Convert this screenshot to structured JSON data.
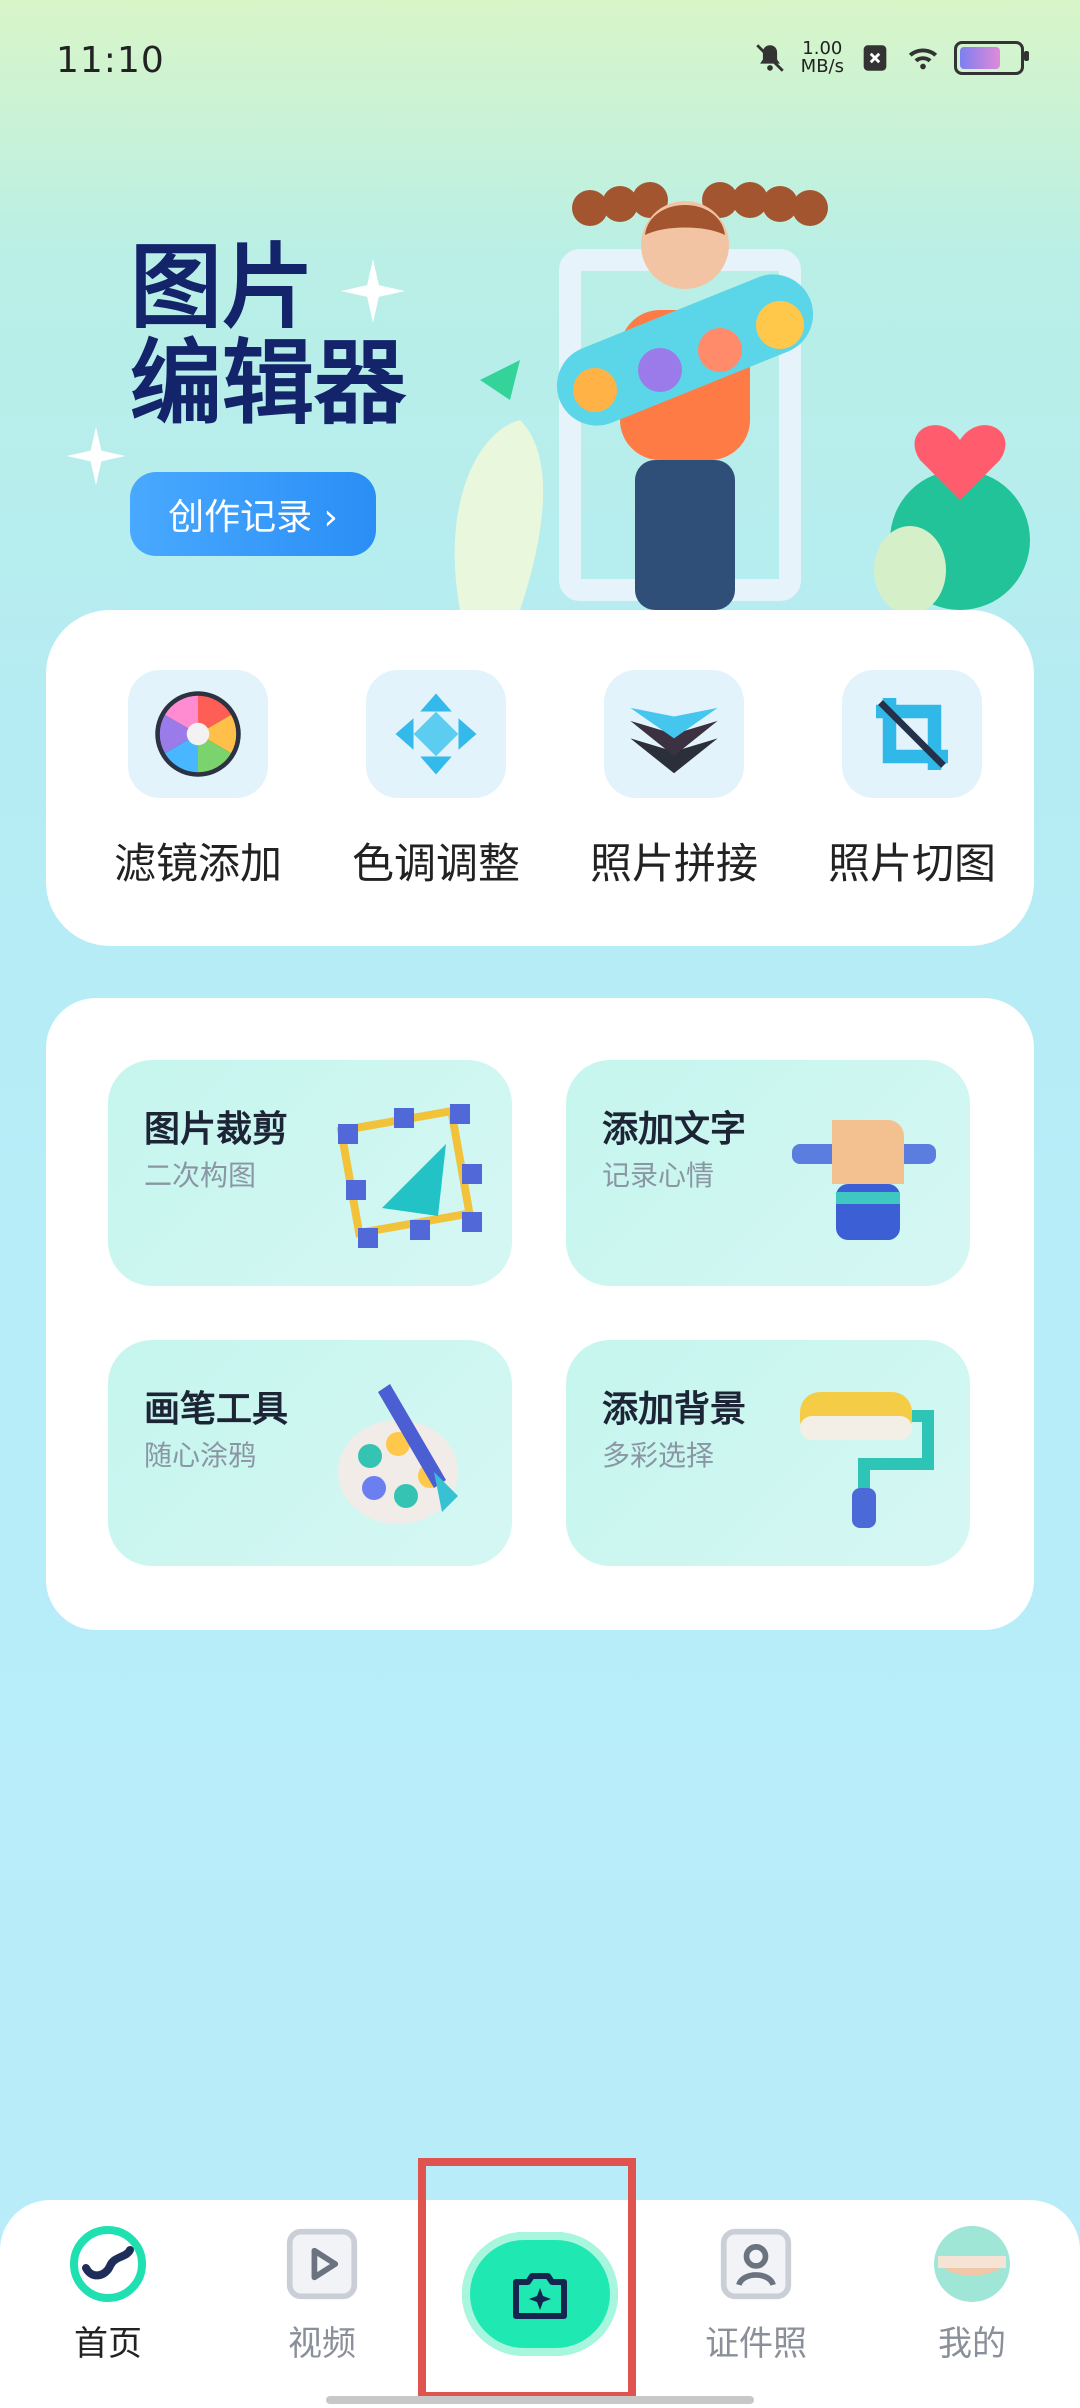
{
  "status_bar": {
    "time": "11:10",
    "network_speed_value": "1.00",
    "network_speed_unit": "MB/s"
  },
  "hero": {
    "title_line1": "图片",
    "title_line2": "编辑器",
    "records_button": "创作记录 ›"
  },
  "tools": [
    {
      "label": "滤镜添加",
      "icon": "color-wheel-icon"
    },
    {
      "label": "色调调整",
      "icon": "diamond-arrows-icon"
    },
    {
      "label": "照片拼接",
      "icon": "layers-icon"
    },
    {
      "label": "照片切图",
      "icon": "crop-frame-icon"
    }
  ],
  "features": [
    {
      "title": "图片裁剪",
      "subtitle": "二次构图",
      "icon": "crop-handles-icon"
    },
    {
      "title": "添加文字",
      "subtitle": "记录心情",
      "icon": "hand-pen-icon"
    },
    {
      "title": "画笔工具",
      "subtitle": "随心涂鸦",
      "icon": "palette-brush-icon"
    },
    {
      "title": "添加背景",
      "subtitle": "多彩选择",
      "icon": "paint-roller-icon"
    }
  ],
  "nav": {
    "home": "首页",
    "video": "视频",
    "id_photo": "证件照",
    "mine": "我的"
  },
  "colors": {
    "accent": "#1fe8b3",
    "title": "#13246b",
    "button": "#2a8ef5",
    "highlight": "#e05450"
  }
}
